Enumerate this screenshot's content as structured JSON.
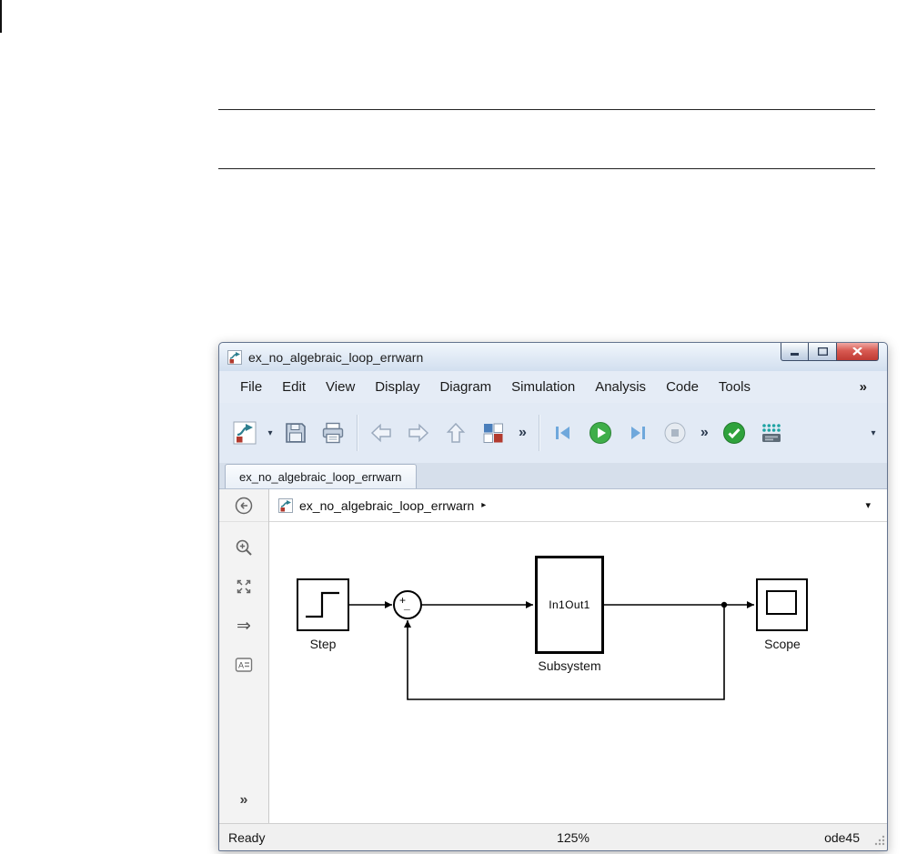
{
  "window": {
    "title": "ex_no_algebraic_loop_errwarn",
    "menu": {
      "items": [
        "File",
        "Edit",
        "View",
        "Display",
        "Diagram",
        "Simulation",
        "Analysis",
        "Code",
        "Tools"
      ],
      "overflow": "»"
    },
    "toolbar": {
      "new_caret": "▾",
      "nav_overflow": "»",
      "sim_overflow": "»",
      "right_caret": "▾"
    },
    "tab": "ex_no_algebraic_loop_errwarn",
    "breadcrumb": {
      "model": "ex_no_algebraic_loop_errwarn",
      "arrow": "▸",
      "caret": "▾"
    },
    "palette": {
      "double_arrow": "⇒",
      "overflow": "»"
    },
    "statusbar": {
      "state": "Ready",
      "zoom": "125%",
      "solver": "ode45"
    }
  },
  "diagram": {
    "step": {
      "label": "Step"
    },
    "sum": {
      "plus": "+",
      "minus": "_"
    },
    "subsystem": {
      "ports": "In1Out1",
      "label": "Subsystem"
    },
    "scope": {
      "label": "Scope"
    }
  },
  "colors": {
    "chrome": "#dce6f2",
    "run_green": "#3fae49",
    "close_red": "#bf3a33"
  }
}
